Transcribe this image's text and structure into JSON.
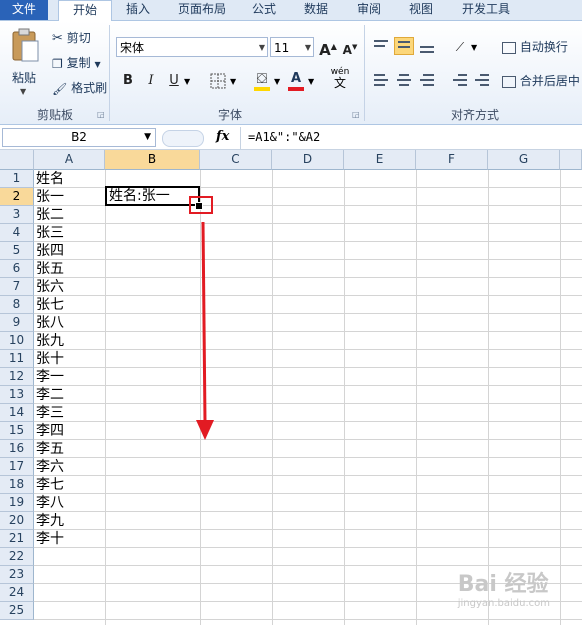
{
  "ribbon_tabs": [
    "文件",
    "开始",
    "插入",
    "页面布局",
    "公式",
    "数据",
    "审阅",
    "视图",
    "开发工具"
  ],
  "clipboard": {
    "paste": "粘贴",
    "cut": "剪切",
    "copy": "复制",
    "format_painter": "格式刷",
    "group": "剪贴板"
  },
  "font": {
    "name": "宋体",
    "size": "11",
    "grow": "A",
    "shrink": "A",
    "bold": "B",
    "italic": "I",
    "underline": "U",
    "fill_letter": "A",
    "wen": "wén",
    "wen_char": "文",
    "group": "字体"
  },
  "alignment": {
    "wrap": "自动换行",
    "merge": "合并后居中",
    "group": "对齐方式"
  },
  "formula_bar": {
    "name_box": "B2",
    "fx": "fx",
    "formula": "=A1&\":\"&A2"
  },
  "columns": [
    "A",
    "B",
    "C",
    "D",
    "E",
    "F",
    "G"
  ],
  "rows": [
    "1",
    "2",
    "3",
    "4",
    "5",
    "6",
    "7",
    "8",
    "9",
    "10",
    "11",
    "12",
    "13",
    "14",
    "15",
    "16",
    "17",
    "18",
    "19",
    "20",
    "21",
    "22",
    "23",
    "24",
    "25"
  ],
  "column_a": [
    "姓名",
    "张一",
    "张二",
    "张三",
    "张四",
    "张五",
    "张六",
    "张七",
    "张八",
    "张九",
    "张十",
    "李一",
    "李二",
    "李三",
    "李四",
    "李五",
    "李六",
    "李七",
    "李八",
    "李九",
    "李十"
  ],
  "selected_cell": {
    "ref": "B2",
    "value": "姓名:张一"
  },
  "accent_colors": {
    "highlight_fill": "#ffd700",
    "font_color": "#e21b23",
    "annotation": "#e21b23"
  },
  "watermark": {
    "text": "Bai 经验",
    "sub": "jingyan.baidu.com"
  }
}
